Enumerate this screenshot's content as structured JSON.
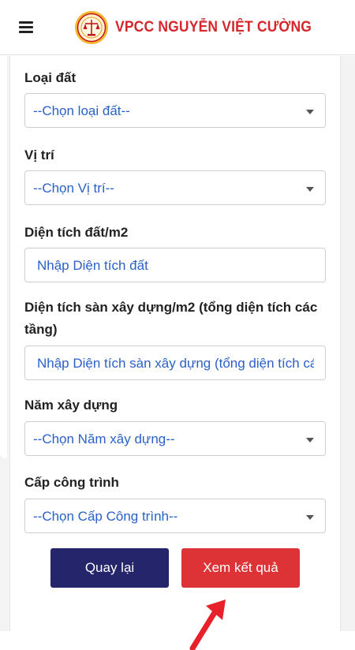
{
  "header": {
    "brand": "VPCC NGUYỄN VIỆT CƯỜNG",
    "menu_icon": "hamburger-menu-icon",
    "logo_icon": "notary-seal-logo"
  },
  "form": {
    "land_type": {
      "label": "Loại đất",
      "selected": "--Chọn loại đất--"
    },
    "location": {
      "label": "Vị trí",
      "selected": "--Chọn Vị trí--"
    },
    "land_area": {
      "label": "Diện tích đất/m2",
      "placeholder": "Nhập Diện tích đất"
    },
    "floor_area": {
      "label": "Diện tích sàn xây dựng/m2 (tổng diện tích các tầng)",
      "placeholder": "Nhập Diện tích sàn xây dựng (tổng diện tích các tầng)"
    },
    "build_year": {
      "label": "Năm xây dựng",
      "selected": "--Chọn Năm xây dựng--"
    },
    "building_grade": {
      "label": "Cấp công trình",
      "selected": "--Chọn Cấp Công trình--"
    }
  },
  "buttons": {
    "back": "Quay lại",
    "result": "Xem kết quả"
  },
  "colors": {
    "brand_red": "#d4262b",
    "back_button": "#24256a",
    "result_button": "#dd3337",
    "field_text": "#2a61c9",
    "annotation_arrow": "#e8202a"
  },
  "annotation": {
    "arrow_icon": "red-arrow-pointing-to-result-button"
  }
}
